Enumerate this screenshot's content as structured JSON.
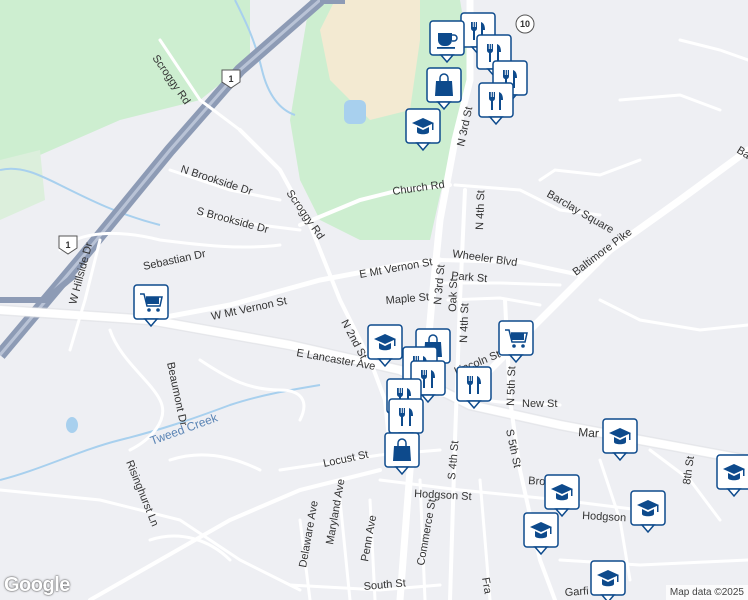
{
  "map": {
    "colors": {
      "background": "#eeeff3",
      "green": "#cdeed0",
      "road": "#ffffff",
      "highway": "#8d9bb5",
      "water": "#a8d0ee",
      "campus": "#f3ead2",
      "pin": "#0d4a8c"
    },
    "streets": {
      "scroggy_rd_top": "Scroggy Rd",
      "scroggy_rd": "Scroggy Rd",
      "n_brookside_dr": "N Brookside Dr",
      "s_brookside_dr": "S Brookside Dr",
      "sebastian_dr": "Sebastian Dr",
      "w_hillside_dr": "W Hillside Dr",
      "church_rd": "Church Rd",
      "e_mt_vernon_st": "E Mt Vernon St",
      "w_mt_vernon_st": "W Mt Vernon St",
      "n_3rd_st": "N 3rd St",
      "n_3rd_st_top": "N 3rd St",
      "n_4th_st": "N 4th St",
      "n_4th_st_lower": "N 4th St",
      "wheeler_blvd": "Wheeler Blvd",
      "barclay_square": "Barclay Square",
      "baltimore_pike": "Baltimore Pike",
      "park_st": "Park St",
      "maple_st": "Maple St",
      "oak_st": "Oak St",
      "n_2nd_st": "N 2nd St",
      "e_lancaster_ave": "E Lancaster Ave",
      "lincoln_st": "Lincoln St",
      "n_5th_st": "N 5th St",
      "new_st": "New St",
      "market_st": "Mar",
      "beaumont_dr": "Beaumont Dr",
      "tweed_creek": "Tweed Creek",
      "locust_st": "Locust St",
      "s_4th_st": "S 4th St",
      "s_5th_st": "S 5th St",
      "brown_st": "Bro",
      "hodgson_st": "Hodgson St",
      "hodgson_st_east": "Hodgson",
      "eighth_st": "8th St",
      "risinghurst_ln": "Risinghurst Ln",
      "delaware_ave": "Delaware Ave",
      "maryland_ave": "Maryland Ave",
      "penn_ave": "Penn Ave",
      "commerce_st": "Commerce St",
      "franklin_st": "Fra",
      "south_st": "South St",
      "garfield_st": "Garfi",
      "ba_edge": "Ba"
    },
    "shields": {
      "us1_north": "1",
      "us1_south": "1",
      "route10": "10"
    },
    "pins": [
      {
        "kind": "restaurant",
        "icon": "fork-knife-icon"
      },
      {
        "kind": "cafe",
        "icon": "coffee-cup-icon"
      },
      {
        "kind": "restaurant",
        "icon": "fork-knife-icon"
      },
      {
        "kind": "restaurant",
        "icon": "fork-knife-icon"
      },
      {
        "kind": "shopping",
        "icon": "shopping-bag-icon"
      },
      {
        "kind": "restaurant",
        "icon": "fork-knife-icon"
      },
      {
        "kind": "school",
        "icon": "graduation-cap-icon"
      },
      {
        "kind": "grocery",
        "icon": "shopping-cart-icon"
      },
      {
        "kind": "grocery",
        "icon": "shopping-cart-icon"
      },
      {
        "kind": "school",
        "icon": "graduation-cap-icon"
      },
      {
        "kind": "shopping",
        "icon": "shopping-bag-icon"
      },
      {
        "kind": "restaurant",
        "icon": "fork-knife-icon"
      },
      {
        "kind": "restaurant",
        "icon": "fork-knife-icon"
      },
      {
        "kind": "restaurant",
        "icon": "fork-knife-icon"
      },
      {
        "kind": "restaurant",
        "icon": "fork-knife-icon"
      },
      {
        "kind": "restaurant",
        "icon": "fork-knife-icon"
      },
      {
        "kind": "shopping",
        "icon": "shopping-bag-icon"
      },
      {
        "kind": "school",
        "icon": "graduation-cap-icon"
      },
      {
        "kind": "school",
        "icon": "graduation-cap-icon"
      },
      {
        "kind": "school",
        "icon": "graduation-cap-icon"
      },
      {
        "kind": "school",
        "icon": "graduation-cap-icon"
      },
      {
        "kind": "school",
        "icon": "graduation-cap-icon"
      },
      {
        "kind": "school",
        "icon": "graduation-cap-icon"
      }
    ],
    "google_logo": "Google",
    "attribution": "Map data ©2025"
  }
}
